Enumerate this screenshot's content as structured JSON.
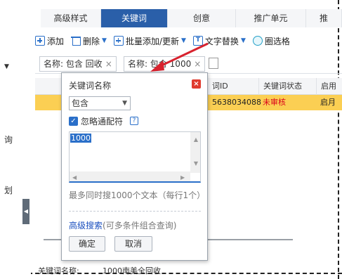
{
  "tabs": [
    {
      "label": "高级样式"
    },
    {
      "label": "关键词",
      "active": true
    },
    {
      "label": "创意"
    },
    {
      "label": "推广单元"
    },
    {
      "label": "推"
    }
  ],
  "toolbar": {
    "add": "添加",
    "delete": "删除",
    "batch": "批量添加/更新",
    "replace": "文字替换",
    "select": "圈选格"
  },
  "filters": {
    "chip1": "名称: 包含 回收",
    "chip2": "名称: 包含 1000",
    "remove": "×"
  },
  "table": {
    "headers": [
      "词ID",
      "关键词状态",
      "启用"
    ],
    "row": {
      "id": "5638034088",
      "status": "未审核",
      "enabled": "启月"
    }
  },
  "left_marks": [
    "询",
    "划"
  ],
  "bottom": {
    "label": "关键词名称:",
    "value": "1000南美全回收"
  },
  "popup": {
    "title": "关键词名称",
    "close": "×",
    "match_select": "包含",
    "ignore_wildcard": "忽略通配符",
    "help": "?",
    "textarea_value": "1000",
    "limit_text": "最多同时搜1000个文本（每行1个）",
    "adv_link": "高级搜索",
    "adv_suffix": "(可多条件组合查询)",
    "ok": "确定",
    "cancel": "取消"
  },
  "colors": {
    "accent": "#2a5fa9",
    "highlight_row": "#fbcf53",
    "status_red": "#d9001b",
    "arrow": "#d8222e"
  }
}
